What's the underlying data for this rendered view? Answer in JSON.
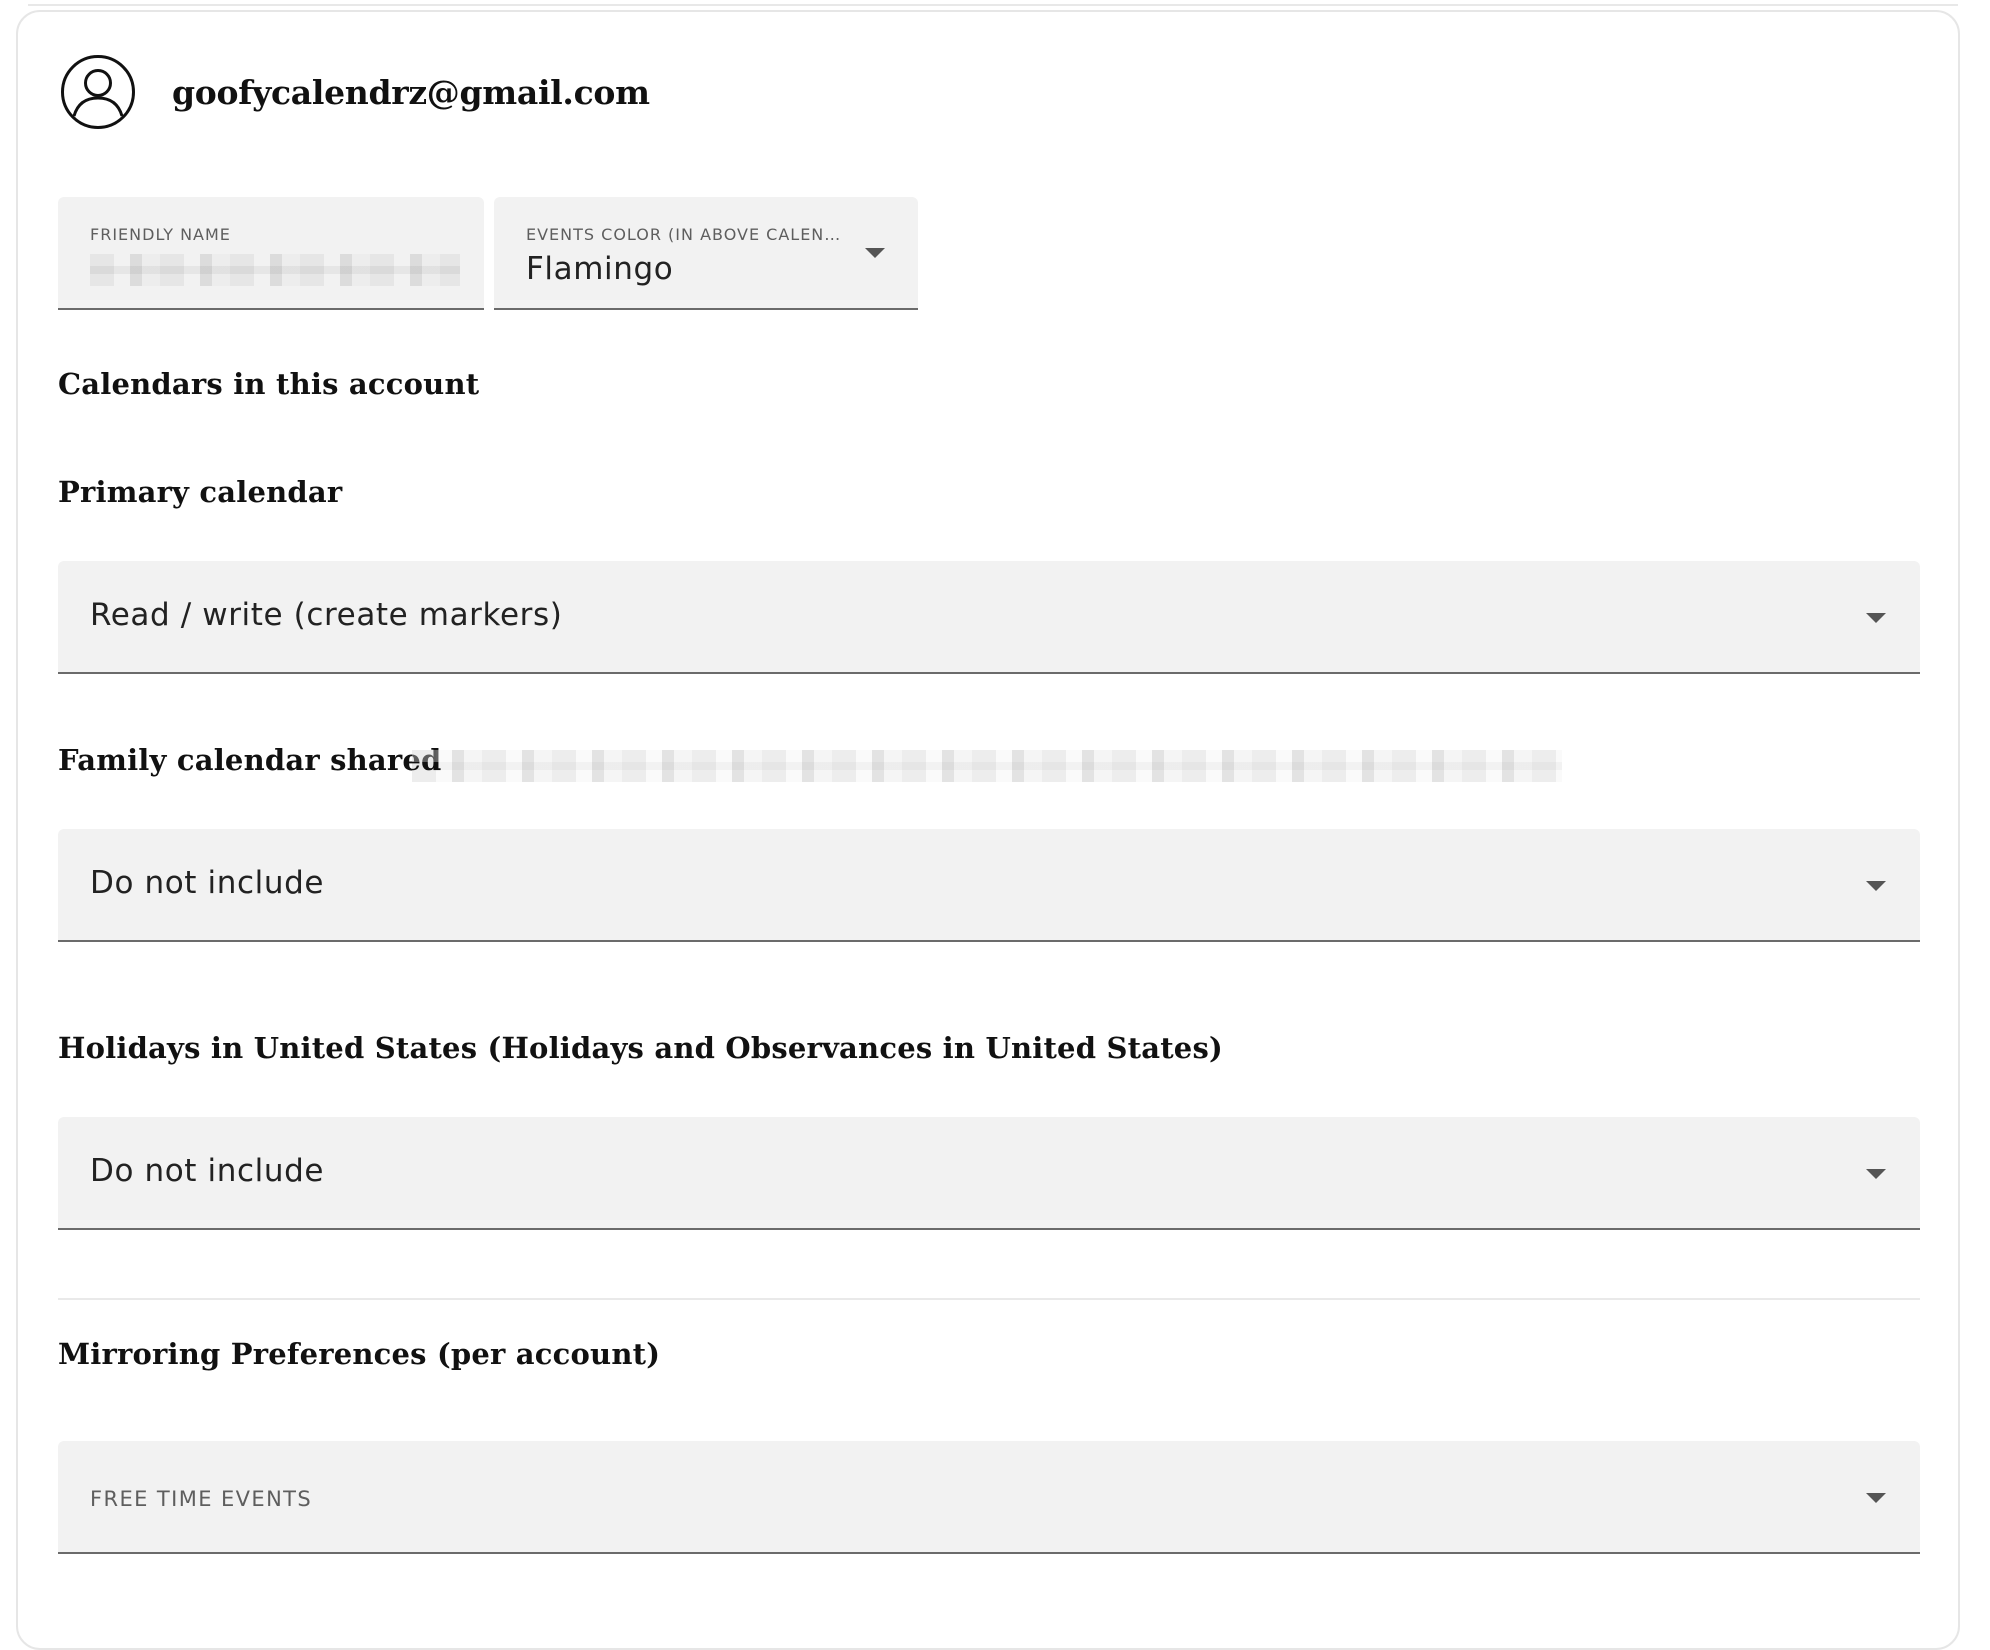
{
  "account": {
    "email": "goofycalendrz@gmail.com",
    "avatar_icon": "account-circle-icon"
  },
  "friendly_name": {
    "label": "FRIENDLY NAME",
    "value": ""
  },
  "events_color": {
    "label": "EVENTS COLOR (IN ABOVE CALENDA...",
    "value": "Flamingo",
    "icon": "chevron-down-icon"
  },
  "calendars_section": {
    "title": "Calendars in this account",
    "calendars": [
      {
        "name": "Primary calendar",
        "option": "Read / write (create markers)"
      },
      {
        "name": "Family calendar shared",
        "option": "Do not include"
      },
      {
        "name": "Holidays in United States (Holidays and Observances in United States)",
        "option": "Do not include"
      }
    ]
  },
  "mirroring": {
    "title": "Mirroring Preferences (per account)",
    "free_time_label": "FREE TIME EVENTS"
  },
  "colors": {
    "field_bg": "#f2f2f2",
    "field_border": "#6b6b6b",
    "text": "#111111"
  }
}
